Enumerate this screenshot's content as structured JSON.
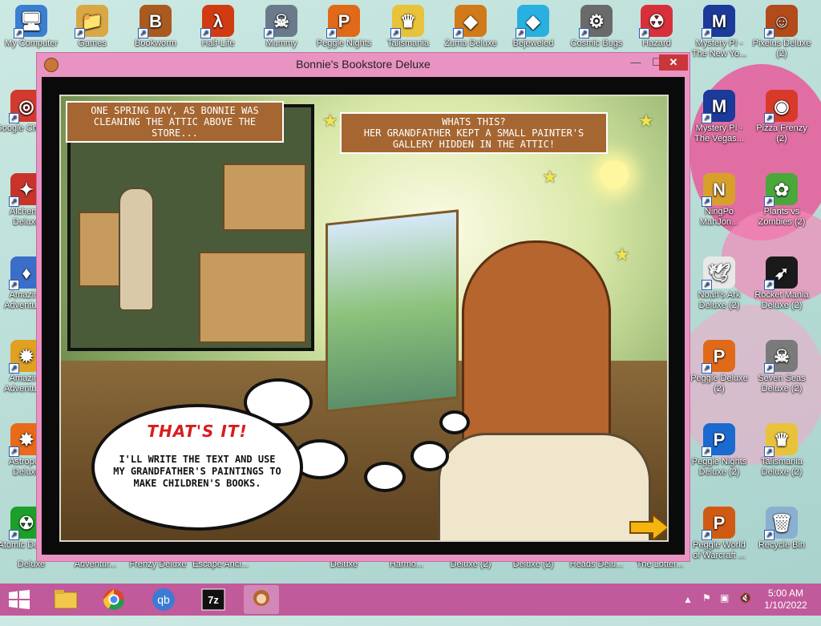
{
  "desktop": {
    "icons_top": [
      {
        "label": "My Computer",
        "glyph": "🖥",
        "color": "#3c7fd1"
      },
      {
        "label": "Games",
        "glyph": "📁",
        "color": "#d9a743"
      },
      {
        "label": "Bookworm",
        "glyph": "B",
        "color": "#a85a1f"
      },
      {
        "label": "Half-Life",
        "glyph": "λ",
        "color": "#d23b12"
      },
      {
        "label": "Mummy",
        "glyph": "☠",
        "color": "#6b7a8a"
      },
      {
        "label": "Peggle Nights",
        "glyph": "P",
        "color": "#e06a1a"
      },
      {
        "label": "Talismania",
        "glyph": "♛",
        "color": "#e8c23a"
      },
      {
        "label": "Zuma Deluxe",
        "glyph": "◆",
        "color": "#d07a1a"
      },
      {
        "label": "Bejeweled",
        "glyph": "◆",
        "color": "#28b0e0"
      },
      {
        "label": "Cosmic Bugs",
        "glyph": "⚙",
        "color": "#6a6a6a"
      },
      {
        "label": "Hazard",
        "glyph": "☢",
        "color": "#d8303a"
      },
      {
        "label": "Mystery PI - The New Yo...",
        "glyph": "M",
        "color": "#1b3a9a"
      },
      {
        "label": "Pixelus Deluxe (2)",
        "glyph": "☺",
        "color": "#b24a1a"
      }
    ],
    "icons_left": [
      {
        "label": "Google Chrome",
        "glyph": "◎",
        "color": "#d2392f"
      },
      {
        "label": "Alchemy Deluxe",
        "glyph": "✦",
        "color": "#c8342a"
      },
      {
        "label": "Amazing Adventures",
        "glyph": "♦",
        "color": "#3a6ec8"
      },
      {
        "label": "Amazing Adventures",
        "glyph": "✹",
        "color": "#e0a020"
      },
      {
        "label": "Astropop Deluxe",
        "glyph": "✸",
        "color": "#e86a1a"
      },
      {
        "label": "Atomic Deluxe",
        "glyph": "☢",
        "color": "#1ba02a"
      }
    ],
    "icons_right_col1": [
      {
        "label": "Mystery PI - The Vegas...",
        "glyph": "M",
        "color": "#1b3a9a"
      },
      {
        "label": "NingPo MahJon...",
        "glyph": "N",
        "color": "#d8a02a"
      },
      {
        "label": "Noah's Ark Deluxe (2)",
        "glyph": "🕊",
        "color": "#e8e8e8"
      },
      {
        "label": "Peggle Deluxe (2)",
        "glyph": "P",
        "color": "#e06a1a"
      },
      {
        "label": "Peggle Nights Deluxe (2)",
        "glyph": "P",
        "color": "#1a6ad0"
      },
      {
        "label": "Peggle World of Warcraft ...",
        "glyph": "P",
        "color": "#d05a12"
      }
    ],
    "icons_right_col2": [
      {
        "label": "Pizza Frenzy (2)",
        "glyph": "◉",
        "color": "#d83a2a"
      },
      {
        "label": "Plants vs Zombies (2)",
        "glyph": "✿",
        "color": "#4aa83a"
      },
      {
        "label": "Rocket Mania Deluxe (2)",
        "glyph": "➶",
        "color": "#1a1a1a"
      },
      {
        "label": "Seven Seas Deluxe (2)",
        "glyph": "☠",
        "color": "#7a7a7a"
      },
      {
        "label": "Talismania Deluxe (2)",
        "glyph": "♛",
        "color": "#e8c23a"
      },
      {
        "label": "Recycle Bin",
        "glyph": "🗑",
        "color": "#8ab0d0"
      }
    ],
    "icons_bottom_labels": [
      "Deluxe",
      "Adventur...",
      "Frenzy Deluxe",
      "Escape Anci...",
      "Deluxe",
      "Harmo...",
      "Deluxe (2)",
      "Deluxe (2)",
      "Heads Delu...",
      "The Lotter..."
    ]
  },
  "window": {
    "title": "Bonnie's Bookstore Deluxe",
    "min_label": "—",
    "max_label": "☐",
    "close_label": "✕"
  },
  "comic": {
    "caption1": "One spring day, as Bonnie was cleaning the attic above the store...",
    "caption2_line1": "Whats this?",
    "caption2_line2": "Her grandfather kept a small painter's gallery hidden in the attic!",
    "shout": "THAT'S IT!",
    "bubble_text": "I'LL WRITE THE TEXT AND USE MY GRANDFATHER'S PAINTINGS TO MAKE CHILDREN'S BOOKS."
  },
  "taskbar": {
    "time": "5:00 AM",
    "date": "1/10/2022",
    "accent": "#c15a9b"
  }
}
